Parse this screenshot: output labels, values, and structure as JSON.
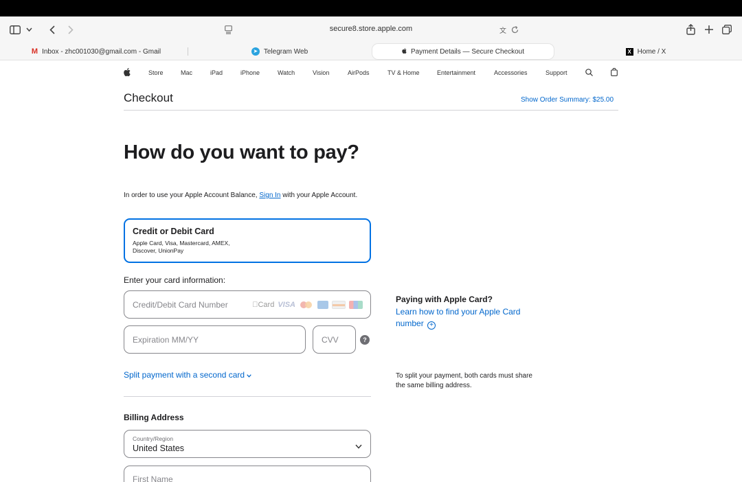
{
  "browser": {
    "url": "secure8.store.apple.com",
    "tabs": [
      {
        "label": "Inbox - zhc001030@gmail.com - Gmail",
        "icon": "gmail-icon"
      },
      {
        "label": "Telegram Web",
        "icon": "telegram-icon"
      },
      {
        "label": "Payment Details — Secure Checkout",
        "icon": "apple-icon",
        "active": true
      },
      {
        "label": "Home / X",
        "icon": "x-icon"
      }
    ]
  },
  "globalnav": {
    "items": [
      "Store",
      "Mac",
      "iPad",
      "iPhone",
      "Watch",
      "Vision",
      "AirPods",
      "TV & Home",
      "Entertainment",
      "Accessories",
      "Support"
    ]
  },
  "checkout": {
    "title": "Checkout",
    "order_summary": "Show Order Summary: $25.00",
    "headline": "How do you want to pay?",
    "balance_prefix": "In order to use your Apple Account Balance,",
    "sign_in": "Sign In",
    "balance_suffix": "with your Apple Account.",
    "card_option": {
      "title": "Credit or Debit Card",
      "description": "Apple Card, Visa, Mastercard, AMEX, Discover, UnionPay"
    },
    "enter_label": "Enter your card information:",
    "card_number_placeholder": "Credit/Debit Card Number",
    "card_logos": [
      "Card",
      "VISA"
    ],
    "expiration_placeholder": "Expiration MM/YY",
    "cvv_placeholder": "CVV",
    "help_symbol": "?",
    "split_link": "Split payment with a second card",
    "billing_title": "Billing Address",
    "country_label": "Country/Region",
    "country_value": "United States",
    "first_name_placeholder": "First Name"
  },
  "sidebar": {
    "apple_card_heading": "Paying with Apple Card?",
    "apple_card_link": "Learn how to find your Apple Card number",
    "split_note": "To split your payment, both cards must share the same billing address."
  },
  "colors": {
    "link": "#0066cc",
    "selected_border": "#0071e3",
    "text": "#1d1d1f"
  }
}
